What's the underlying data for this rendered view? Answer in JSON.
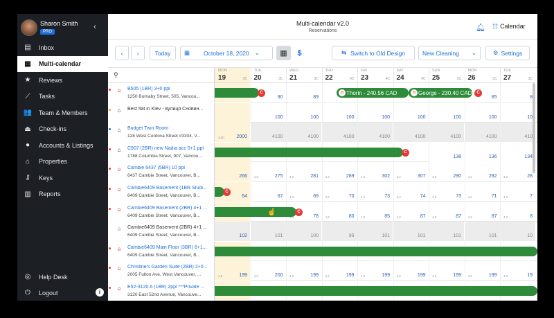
{
  "app": {
    "title": "Multi-calendar v2.0",
    "subtitle": "Reservations",
    "calendar_label": "Calendar"
  },
  "user": {
    "name": "Sharon Smith",
    "plan": "PRO"
  },
  "nav": [
    {
      "label": "Inbox",
      "icon": "inbox-icon",
      "glyph": "▤"
    },
    {
      "label": "Multi-calendar",
      "icon": "calendar-icon",
      "glyph": "▦",
      "active": true
    },
    {
      "label": "Reviews",
      "icon": "star-icon",
      "glyph": "★"
    },
    {
      "label": "Tasks",
      "icon": "broom-icon",
      "glyph": "⟋"
    },
    {
      "label": "Team & Members",
      "icon": "team-icon",
      "glyph": "👥"
    },
    {
      "label": "Check-ins",
      "icon": "bell-service-icon",
      "glyph": "⏏"
    },
    {
      "label": "Accounts & Listings",
      "icon": "account-icon",
      "glyph": "●"
    },
    {
      "label": "Properties",
      "icon": "home-icon",
      "glyph": "⌂"
    },
    {
      "label": "Keys",
      "icon": "key-icon",
      "glyph": "⚷"
    },
    {
      "label": "Reports",
      "icon": "report-icon",
      "glyph": "▥"
    }
  ],
  "bottom_nav": [
    {
      "label": "Help Desk",
      "icon": "help-icon",
      "glyph": "◎"
    },
    {
      "label": "Logout",
      "icon": "power-icon",
      "glyph": "⏻"
    }
  ],
  "toolbar": {
    "today": "Today",
    "date": "October 18, 2020",
    "switch": "Switch to Old Design",
    "new_cleaning": "New Cleaning",
    "settings": "Settings"
  },
  "days": [
    {
      "name": "MON",
      "num": "19",
      "min": "3C"
    },
    {
      "name": "TUE",
      "num": "20",
      "min": "3C"
    },
    {
      "name": "WED",
      "num": "21",
      "min": "3C"
    },
    {
      "name": "THU",
      "num": "22",
      "min": "4C"
    },
    {
      "name": "FRI",
      "num": "23",
      "min": "4C"
    },
    {
      "name": "SAT",
      "num": "24",
      "min": "4C"
    },
    {
      "name": "SUN",
      "num": "25",
      "min": "3C"
    },
    {
      "name": "MON",
      "num": "26",
      "min": "3C"
    },
    {
      "name": "TUE",
      "num": "27",
      "min": "3C"
    }
  ],
  "listings": [
    {
      "name": "B505 (1BR) 3+0 ppl",
      "addr": "1250 Burnaby Street, 505, Vancou...",
      "tag": "#e53935",
      "icon": "airbnb",
      "prices": [
        "",
        "90",
        "89",
        "",
        "",
        "",
        "",
        "85",
        "8"
      ],
      "mins": [
        "",
        "",
        "",
        "",
        "",
        "",
        "",
        "",
        ""
      ]
    },
    {
      "name": "Best flat in Kiev - вулиця Сновин...",
      "addr": "",
      "tag": "#f0a030",
      "icon": "home",
      "prices": [
        "",
        "100",
        "100",
        "100",
        "100",
        "100",
        "100",
        "100",
        "10"
      ],
      "mins": [
        "",
        "",
        "",
        "",
        "",
        "",
        "",
        "",
        ""
      ]
    },
    {
      "name": "Budget Twin Room",
      "addr": "128 West Cordova Street #3304, V...",
      "tag": "#1e6fd9",
      "icon": "home",
      "prices": [
        "2000",
        "4100",
        "4100",
        "4100",
        "4100",
        "4100",
        "4100",
        "4100",
        "410"
      ],
      "mins": [
        "4,50",
        "",
        "",
        "",
        "",
        "",
        "",
        "",
        ""
      ]
    },
    {
      "name": "C907 (2BR) new Nadia acc 5+1 ppl",
      "addr": "1788 Columbia Street, 907, Vancou...",
      "tag": "#e53935",
      "icon": "home",
      "prices": [
        "",
        "",
        "",
        "",
        "",
        "",
        "138",
        "136",
        "134"
      ],
      "mins": [
        "",
        "",
        "",
        "",
        "",
        "",
        "",
        "",
        ""
      ]
    },
    {
      "name": "Cambie 6437 (5BR) 10 ppl",
      "addr": "6437 Cambie Street, Vancouver, B...",
      "tag": "#e53935",
      "icon": "airbnb",
      "prices": [
        "266",
        "275",
        "281",
        "289",
        "302",
        "307",
        "290",
        "282",
        "28"
      ],
      "mins": [
        "",
        "4,2",
        "4,2",
        "4,2",
        "4,2",
        "4,2",
        "4,2",
        "4,2",
        "4,2"
      ]
    },
    {
      "name": "Cambie6409 Basement (1BR Studi...",
      "addr": "6409 Cambie Street, Vancouver, B...",
      "tag": "#e53935",
      "icon": "airbnb",
      "prices": [
        "64",
        "67",
        "69",
        "70",
        "73",
        "74",
        "73",
        "71",
        "7"
      ],
      "mins": [
        "",
        "",
        "4,2",
        "4,2",
        "4,2",
        "4,2",
        "4,2",
        "4,2",
        "4,2"
      ]
    },
    {
      "name": "Cambie6409 Basement (2BR) 4+1 ...",
      "addr": "6409 Cambie Street, Vancouver, B...",
      "tag": "#e53935",
      "icon": "airbnb",
      "prices": [
        "",
        "",
        "78",
        "80",
        "85",
        "87",
        "87",
        "87",
        "8"
      ],
      "mins": [
        "",
        "",
        "4,2",
        "4,2",
        "4,2",
        "4,2",
        "4,2",
        "4,2",
        "4,2"
      ]
    },
    {
      "name": "Cambie6409 Basement (2BR) 4+1 ...",
      "addr": "6409 Cambie Street, Vancouver, B...",
      "tag": "",
      "icon": "airbnb-gray",
      "prices": [
        "102",
        "101",
        "100",
        "99",
        "101",
        "101",
        "101",
        "101",
        "10"
      ],
      "mins": [
        "",
        "",
        "",
        "",
        "",
        "",
        "",
        "",
        ""
      ]
    },
    {
      "name": "Cambie6409 Main Floor (3BR) 6+1...",
      "addr": "6409 Cambie Street, Vancouver, B...",
      "tag": "#e53935",
      "icon": "airbnb",
      "prices": [
        "",
        "",
        "",
        "",
        "",
        "",
        "",
        "",
        ""
      ],
      "mins": [
        "",
        "",
        "",
        "",
        "",
        "",
        "",
        "",
        ""
      ]
    },
    {
      "name": "Christine's Garden Suite (2BR) 2+0...",
      "addr": "2005 Fulton Ave, West Vancouver, ...",
      "tag": "#e53935",
      "icon": "airbnb",
      "prices": [
        "199",
        "200",
        "199",
        "199",
        "199",
        "199",
        "199",
        "199",
        "19"
      ],
      "mins": [
        "4,2",
        "4,2",
        "4,2",
        "4,2",
        "4,2",
        "4,2",
        "4,2",
        "4,2",
        "4,2"
      ]
    },
    {
      "name": "E52-3120 A (1BR) 2ppl ***Private ...",
      "addr": "3120 East 52nd Avenue, Vancouve...",
      "tag": "#e53935",
      "icon": "airbnb",
      "prices": [
        "",
        "",
        "",
        "",
        "",
        "",
        "",
        "",
        ""
      ],
      "mins": [
        "",
        "",
        "",
        "",
        "",
        "",
        "",
        "",
        ""
      ]
    }
  ],
  "reservations": [
    {
      "label": "Thorin - 240.56 CAD",
      "badge": "C"
    },
    {
      "label": "George - 230.40 CAD",
      "badge": "C"
    }
  ],
  "badge_letter": "C",
  "colors": {
    "accent": "#1e6fd9",
    "booking": "#2e8b3a",
    "alert": "#e53935",
    "sidebar": "#1c1f24"
  }
}
